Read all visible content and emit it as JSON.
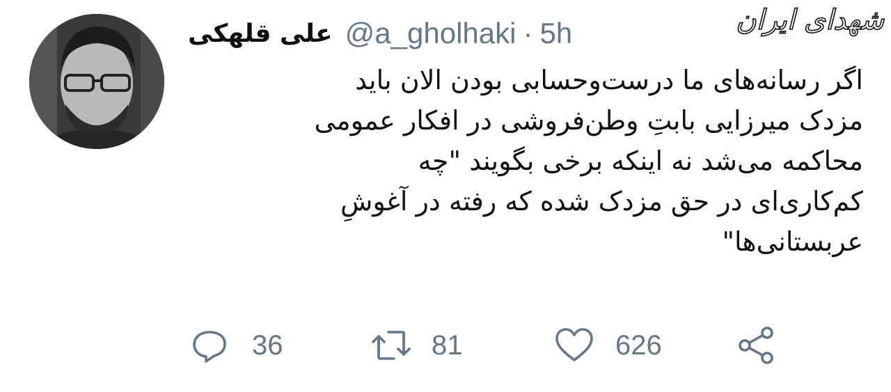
{
  "tweet": {
    "author_name": "علی قلهکی",
    "handle": "@a_gholhaki",
    "separator": "·",
    "time": "5h",
    "lines": [
      "اگر رسانه‌های ما درست‌وحسابی بودن الان باید",
      "مزدک میرزایی بابتِ وطن‌فروشی در افکار عمومی",
      "محاکمه می‌شد نه اینکه برخی بگویند \"چه",
      "کم‌کاری‌ای در حق مزدک شده که رفته در آغوشِ",
      "عربستانی‌ها\""
    ]
  },
  "actions": {
    "reply": {
      "icon": "reply-icon",
      "count": "36"
    },
    "retweet": {
      "icon": "retweet-icon",
      "count": "81"
    },
    "like": {
      "icon": "heart-icon",
      "count": "626"
    },
    "share": {
      "icon": "share-icon"
    }
  },
  "watermark": "شهدای ایران",
  "colors": {
    "secondary_text": "#657786",
    "primary_text": "#111111",
    "background": "#ffffff"
  }
}
